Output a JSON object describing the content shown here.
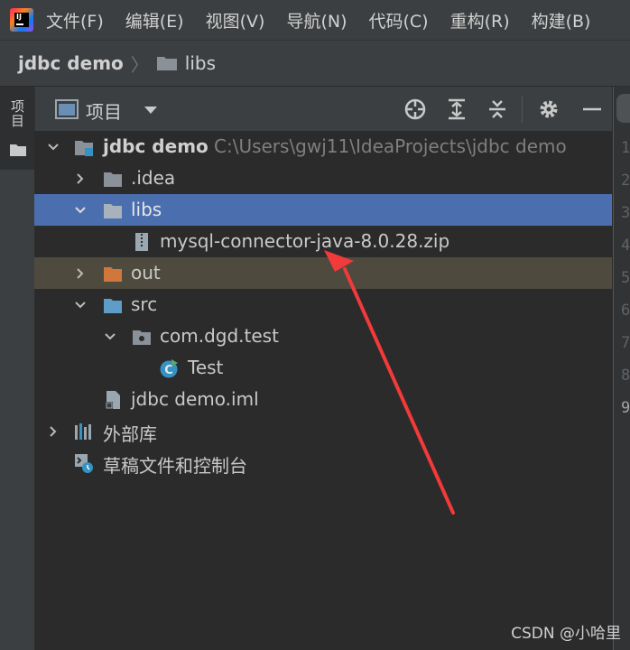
{
  "menubar": {
    "items": [
      "文件(F)",
      "编辑(E)",
      "视图(V)",
      "导航(N)",
      "代码(C)",
      "重构(R)",
      "构建(B)"
    ]
  },
  "breadcrumb": {
    "root": "jdbc demo",
    "child": "libs"
  },
  "left_strip": {
    "tab_label": "项目"
  },
  "panel": {
    "title": "项目"
  },
  "tree": {
    "root_name": "jdbc demo",
    "root_path": "C:\\Users\\gwj11\\IdeaProjects\\jdbc demo",
    "idea": ".idea",
    "libs": "libs",
    "zip": "mysql-connector-java-8.0.28.zip",
    "out": "out",
    "src": "src",
    "package": "com.dgd.test",
    "test_class": "Test",
    "iml": "jdbc demo.iml",
    "external_libs": "外部库",
    "scratches": "草稿文件和控制台"
  },
  "gutter": {
    "line_numbers": [
      "1",
      "2",
      "3",
      "4",
      "5",
      "6",
      "7",
      "8",
      "9"
    ]
  },
  "watermark": "CSDN @小哈里",
  "colors": {
    "selection": "#4b6eaf",
    "excluded_row": "#4e4a3e",
    "annotation_arrow": "#f23a3a",
    "folder": "#8a9199",
    "source_folder": "#5e9dc7",
    "excluded_folder": "#d0783c"
  }
}
